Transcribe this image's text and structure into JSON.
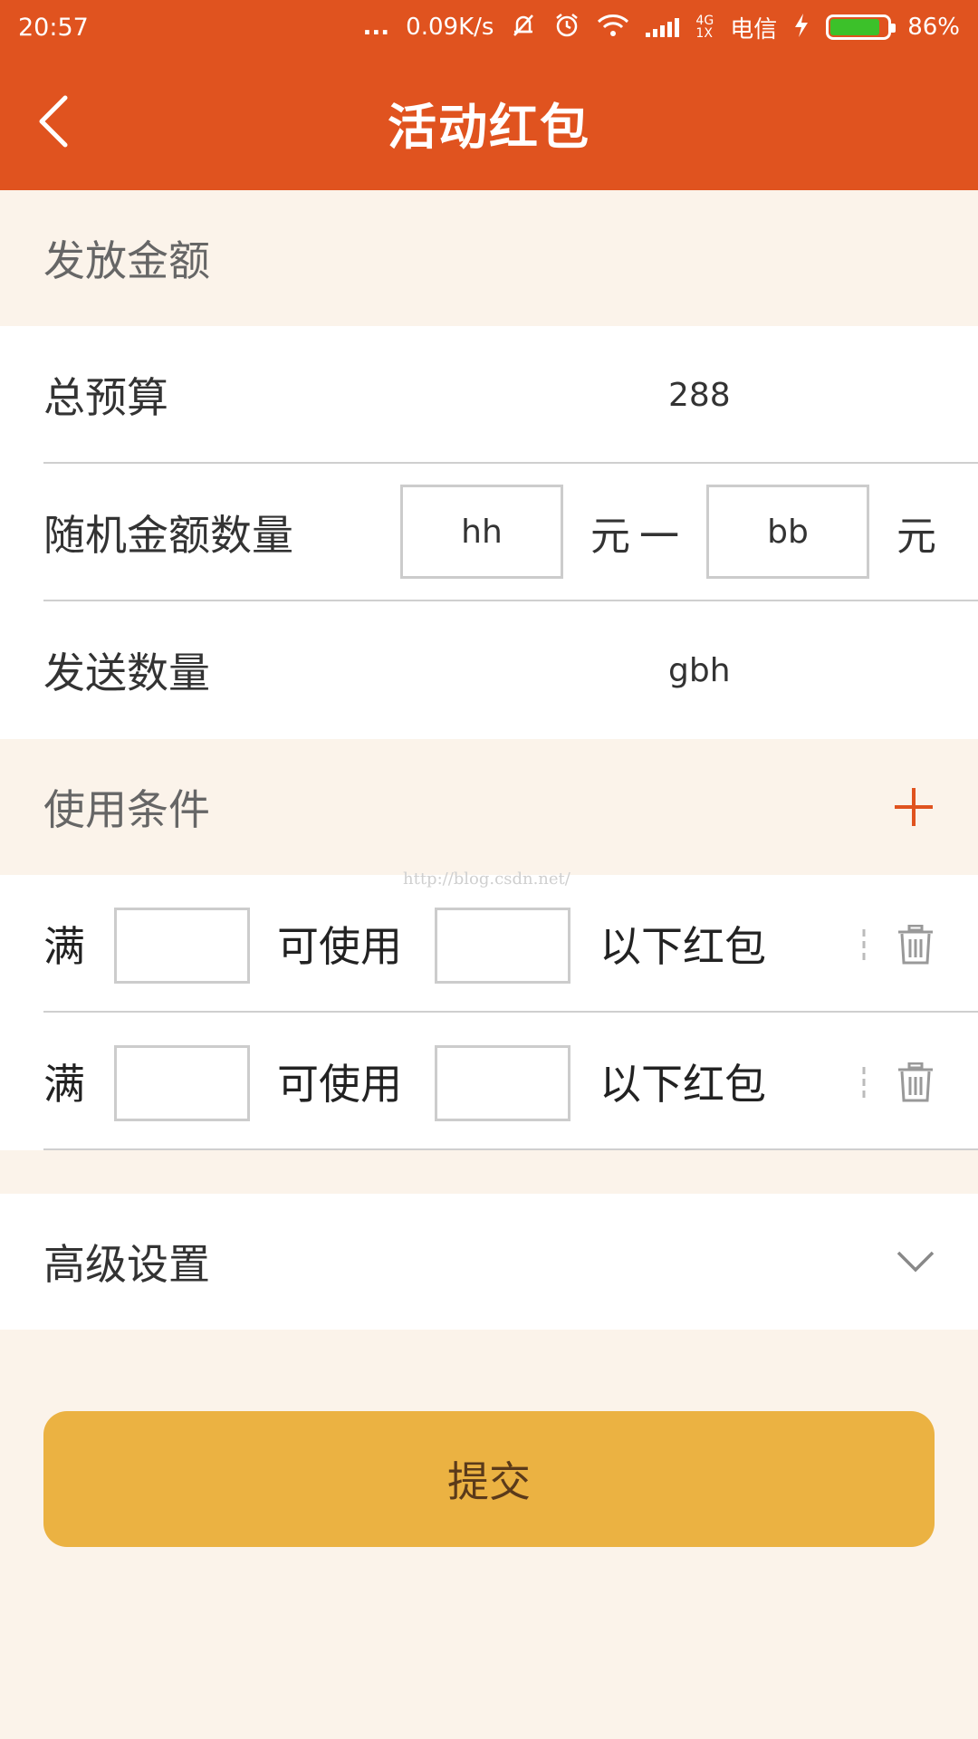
{
  "status_bar": {
    "time": "20:57",
    "dots": "...",
    "net_speed": "0.09K/s",
    "net_type_top": "4G",
    "net_type_bottom": "1X",
    "carrier": "电信",
    "battery": "86%",
    "battery_level": 0.86,
    "icons": [
      "mute-bell-icon",
      "alarm-icon",
      "wifi-icon",
      "signal-icon",
      "charging-icon",
      "battery-icon"
    ]
  },
  "header": {
    "title": "活动红包",
    "back_icon": "chevron-left-icon"
  },
  "section_amount": {
    "title": "发放金额"
  },
  "total_budget": {
    "label": "总预算",
    "value": "288"
  },
  "random_amount": {
    "label": "随机金额数量",
    "min_value": "hh",
    "unit1": "元",
    "separator": "一",
    "max_value": "bb",
    "unit2": "元"
  },
  "send_count": {
    "label": "发送数量",
    "value": "gbh"
  },
  "section_conditions": {
    "title": "使用条件",
    "add_icon": "plus-icon"
  },
  "conditions": [
    {
      "prefix": "满",
      "middle": "可使用",
      "suffix": "以下红包",
      "delete_icon": "trash-icon"
    },
    {
      "prefix": "满",
      "middle": "可使用",
      "suffix": "以下红包",
      "delete_icon": "trash-icon"
    }
  ],
  "advanced": {
    "label": "高级设置",
    "expand_icon": "chevron-down-icon"
  },
  "submit": {
    "label": "提交"
  },
  "watermark": "http://blog.csdn.net/",
  "colors": {
    "primary": "#e0531f",
    "accent": "#ebb242",
    "background": "#fbf3ea"
  }
}
